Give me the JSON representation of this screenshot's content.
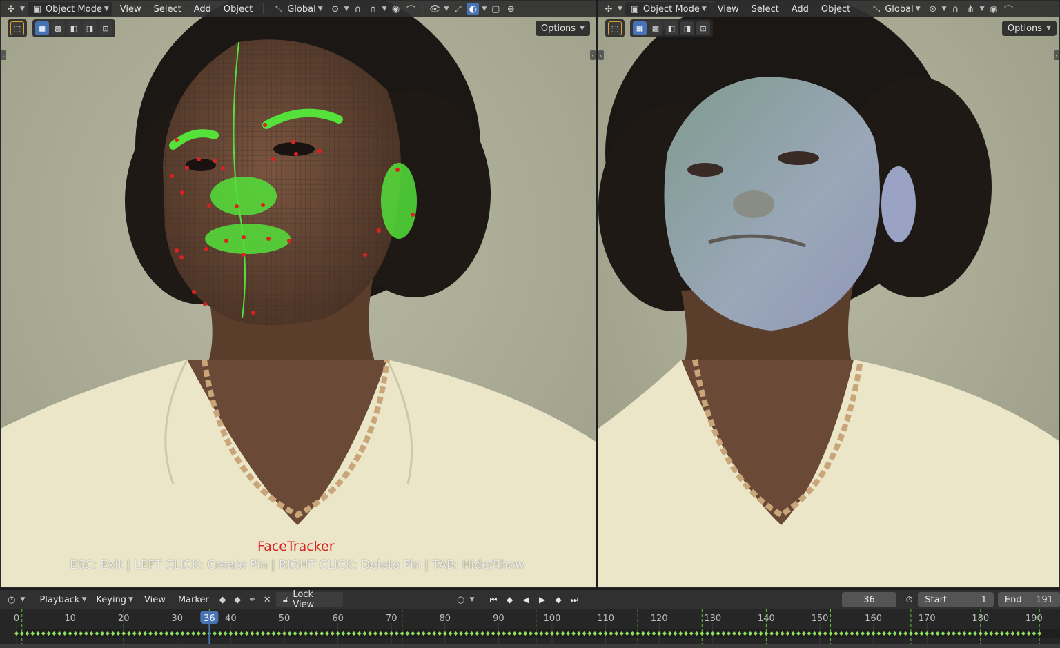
{
  "left_viewport": {
    "header": {
      "mode": "Object Mode",
      "menus": [
        "View",
        "Select",
        "Add",
        "Object"
      ],
      "transform_orientation": "Global"
    },
    "options_label": "Options",
    "overlay_title": "FaceTracker",
    "overlay_help": "ESC: Exit | LEFT CLICK: Create Pin | RIGHT CLICK: Delete Pin | TAB: Hide/Show"
  },
  "right_viewport": {
    "header": {
      "mode": "Object Mode",
      "menus": [
        "View",
        "Select",
        "Add",
        "Object"
      ],
      "transform_orientation": "Global"
    },
    "options_label": "Options"
  },
  "timeline": {
    "menus": [
      "Playback",
      "Keying",
      "View",
      "Marker"
    ],
    "lock_view_label": "Lock View",
    "current_frame": "36",
    "start_label": "Start",
    "start_value": "1",
    "end_label": "End",
    "end_value": "191",
    "ruler_labels": [
      "0",
      "10",
      "20",
      "30",
      "40",
      "50",
      "60",
      "70",
      "80",
      "90",
      "100",
      "110",
      "120",
      "130",
      "140",
      "150",
      "160",
      "170",
      "180",
      "190"
    ],
    "current_frame_marker": "36"
  },
  "colors": {
    "accent": "#4772b3",
    "overlay_title": "#d72323",
    "mesh_green": "#54e13a",
    "pin_red": "#e01f1f",
    "keyframe_green": "#8fe05e"
  }
}
